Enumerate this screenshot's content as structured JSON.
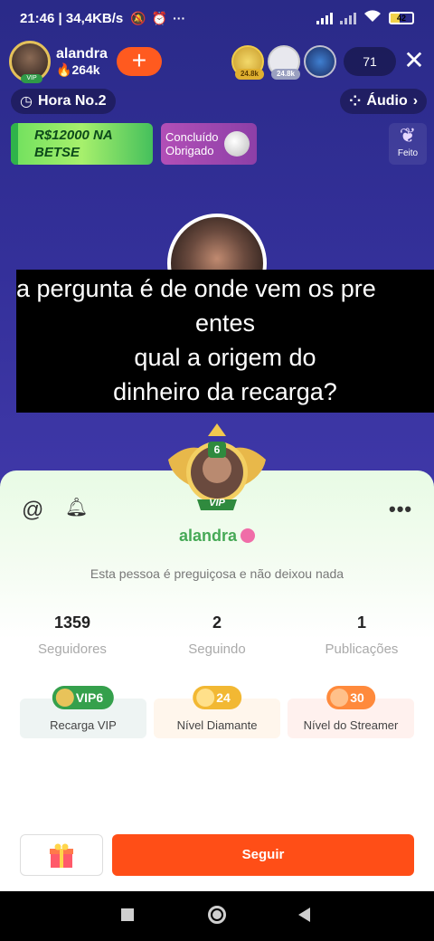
{
  "status_bar": {
    "left_text": "21:46 | 34,4KB/s",
    "battery": "42"
  },
  "host": {
    "name": "alandra",
    "followers": "264k",
    "vip_label": "VIP"
  },
  "viewers": {
    "badges": [
      "24.8k",
      "24.8k"
    ],
    "count": "71"
  },
  "hour_pill": "Hora No.2",
  "audio_pill": "Áudio",
  "banners": {
    "promo_line1": "R$12000 NA",
    "promo_line2": "BETSE",
    "task_line1": "Concluído",
    "task_line2": "Obrigado",
    "feito": "Feito"
  },
  "caption_lines": [
    "a pergunta é de onde vem os pre",
    "entes",
    "qual a origem do",
    "dinheiro da recarga?"
  ],
  "profile": {
    "level_badge": "6",
    "vip_label": "VIP",
    "name": "alandra",
    "bio": "Esta pessoa é preguiçosa e não deixou nada",
    "stats": [
      {
        "value": "1359",
        "label": "Seguidores"
      },
      {
        "value": "2",
        "label": "Seguindo"
      },
      {
        "value": "1",
        "label": "Publicações"
      }
    ],
    "levels": [
      {
        "badge": "VIP6",
        "label": "Recarga VIP",
        "color": "#3aa24f"
      },
      {
        "badge": "24",
        "label": "Nível Diamante",
        "color": "#f2b833"
      },
      {
        "badge": "30",
        "label": "Nível do Streamer",
        "color": "#ff8a3c"
      }
    ],
    "follow_label": "Seguir"
  },
  "colors": {
    "accent": "#ff4e17",
    "name_green": "#46a956",
    "background": "#34309a"
  }
}
